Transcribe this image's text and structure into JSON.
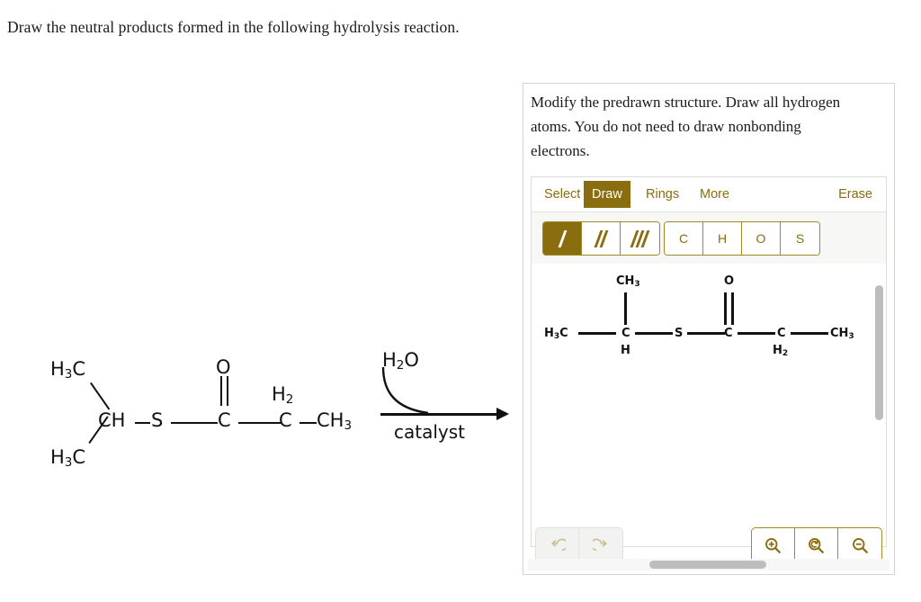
{
  "question": {
    "prompt": "Draw the neutral products formed in the following hydrolysis reaction."
  },
  "reaction": {
    "reactant": {
      "labels": {
        "methyl_top": "H3C",
        "methyl_bottom": "H3C",
        "ch": "CH",
        "sulfur": "S",
        "carbonyl_c": "C",
        "carbonyl_o": "O",
        "ch2": "H2",
        "ch2_c": "C",
        "terminal_ch3": "CH3"
      }
    },
    "arrow": {
      "reagent_above": "H2O",
      "reagent_below": "catalyst"
    }
  },
  "panel": {
    "instructions": "Modify the predrawn structure. Draw all hydrogen atoms. You do not need to draw nonbonding electrons.",
    "tabs": [
      {
        "label": "Select",
        "active": false
      },
      {
        "label": "Draw",
        "active": true
      },
      {
        "label": "Rings",
        "active": false
      },
      {
        "label": "More",
        "active": false
      }
    ],
    "erase_label": "Erase",
    "bond_tools": [
      {
        "name": "single-bond",
        "active": true
      },
      {
        "name": "double-bond",
        "active": false
      },
      {
        "name": "triple-bond",
        "active": false
      }
    ],
    "element_tools": [
      {
        "label": "C"
      },
      {
        "label": "H"
      },
      {
        "label": "O"
      },
      {
        "label": "S"
      }
    ],
    "history_tools": [
      {
        "name": "undo",
        "glyph": "↺",
        "enabled": false
      },
      {
        "name": "redo",
        "glyph": "↻",
        "enabled": false
      }
    ],
    "zoom_tools": [
      {
        "name": "zoom-in",
        "glyph": "+"
      },
      {
        "name": "reset-zoom",
        "glyph": "↺"
      },
      {
        "name": "zoom-out",
        "glyph": "−"
      }
    ],
    "canvas_molecule": {
      "labels": {
        "left_methyl": "H3C",
        "branch_methyl": "CH3",
        "center_c": "C",
        "center_h": "H",
        "sulfur": "S",
        "carbonyl_c": "C",
        "carbonyl_o": "O",
        "ch2_c": "C",
        "ch2_h": "H2",
        "right_methyl": "CH3"
      }
    }
  },
  "colors": {
    "accent_gold": "#8a6d0e",
    "accent_border": "#a08a26",
    "disabled_icon": "#c8bd92",
    "scrollbar": "#bdbdbd",
    "structure_ink": "#121212"
  }
}
